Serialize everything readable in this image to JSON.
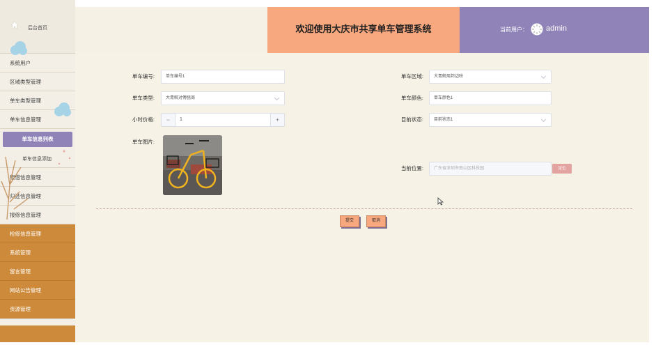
{
  "sidebar": {
    "home_label": "后台首页",
    "items": [
      {
        "label": "系统用户"
      },
      {
        "label": "区域类型管理"
      },
      {
        "label": "单车类型管理"
      },
      {
        "label": "单车信息管理"
      },
      {
        "label": "单车信息列表"
      },
      {
        "label": "单车信息添加"
      },
      {
        "label": "租借信息管理"
      },
      {
        "label": "归还信息管理"
      },
      {
        "label": "报修信息管理"
      },
      {
        "label": "检修信息管理"
      },
      {
        "label": "系统管理"
      },
      {
        "label": "留言管理"
      },
      {
        "label": "网站公告管理"
      },
      {
        "label": "资源管理"
      }
    ]
  },
  "header": {
    "title": "欢迎使用大庆市共享单车管理系统",
    "user_label": "当前用户：",
    "username": "admin"
  },
  "form": {
    "bike_no_label": "单车编号:",
    "bike_no_value": "单车编号1",
    "bike_type_label": "单车类型:",
    "bike_type_value": "大青鲩对傅琵周",
    "hourly_price_label": "小时价格:",
    "hourly_price_value": "1",
    "photo_label": "单车图片:",
    "area_label": "单车区域:",
    "area_value": "大青鲩周邦边吩",
    "color_label": "单车颜色:",
    "color_value": "单车颜色1",
    "status_label": "目前状态:",
    "status_value": "目前状态1",
    "location_label": "当前位置:",
    "location_placeholder": "广东省深圳市南山区科技园",
    "locate_label": "定位",
    "submit_label": "提交",
    "cancel_label": "取消"
  },
  "colors": {
    "accent_orange": "#f8a87f",
    "accent_purple": "#8f83b8",
    "sidebar_orange": "#cd8a3a",
    "background": "#f6f2e6"
  }
}
